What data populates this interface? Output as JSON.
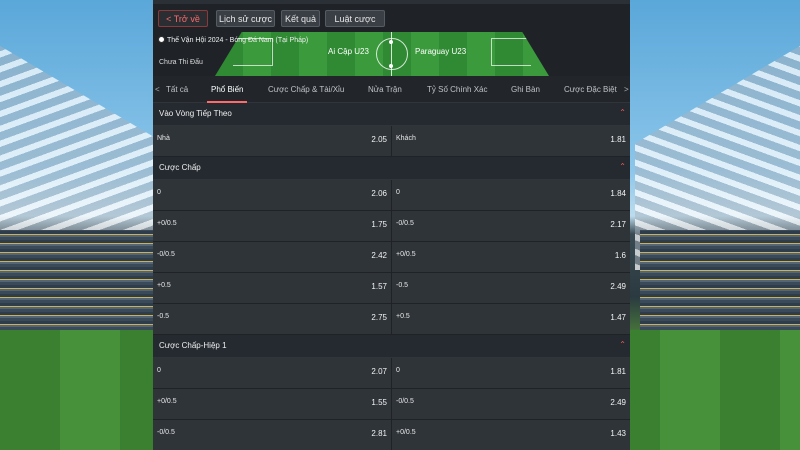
{
  "toolbar": {
    "back_label": "< Trở về",
    "history_label": "Lịch sử cược",
    "results_label": "Kết quả",
    "rules_label": "Luật cược"
  },
  "match": {
    "title": "Thế Vận Hội 2024 - Bóng Đá Nam (Tại Pháp)",
    "status": "Chưa Thi Đấu",
    "home_team": "Ai Cập U23",
    "away_team": "Paraguay U23"
  },
  "tabs": {
    "prev": "<",
    "next": ">",
    "items": [
      {
        "label": "Tất cả"
      },
      {
        "label": "Phổ Biến"
      },
      {
        "label": "Cược Chấp & Tài/Xỉu"
      },
      {
        "label": "Nửa Trận"
      },
      {
        "label": "Tỷ Số Chính Xác"
      },
      {
        "label": "Ghi Bàn"
      },
      {
        "label": "Cược Đặc Biệt"
      }
    ],
    "active_index": 1
  },
  "sections": [
    {
      "title": "Vào Vòng Tiếp Theo",
      "rows": [
        {
          "left": {
            "label": "Nhà",
            "odd": "2.05"
          },
          "right": {
            "label": "Khách",
            "odd": "1.81"
          }
        }
      ]
    },
    {
      "title": "Cược Chấp",
      "rows": [
        {
          "left": {
            "label": "0",
            "odd": "2.06"
          },
          "right": {
            "label": "0",
            "odd": "1.84"
          }
        },
        {
          "left": {
            "label": "+0/0.5",
            "odd": "1.75"
          },
          "right": {
            "label": "-0/0.5",
            "odd": "2.17"
          }
        },
        {
          "left": {
            "label": "-0/0.5",
            "odd": "2.42"
          },
          "right": {
            "label": "+0/0.5",
            "odd": "1.6"
          }
        },
        {
          "left": {
            "label": "+0.5",
            "odd": "1.57"
          },
          "right": {
            "label": "-0.5",
            "odd": "2.49"
          }
        },
        {
          "left": {
            "label": "-0.5",
            "odd": "2.75"
          },
          "right": {
            "label": "+0.5",
            "odd": "1.47"
          }
        }
      ]
    },
    {
      "title": "Cược Chấp-Hiệp 1",
      "rows": [
        {
          "left": {
            "label": "0",
            "odd": "2.07"
          },
          "right": {
            "label": "0",
            "odd": "1.81"
          }
        },
        {
          "left": {
            "label": "+0/0.5",
            "odd": "1.55"
          },
          "right": {
            "label": "-0/0.5",
            "odd": "2.49"
          }
        },
        {
          "left": {
            "label": "-0/0.5",
            "odd": "2.81"
          },
          "right": {
            "label": "+0/0.5",
            "odd": "1.43"
          }
        }
      ]
    }
  ],
  "icons": {
    "collapse": "chevron-up-icon",
    "ball": "soccer-ball-icon"
  },
  "colors": {
    "accent": "#ff6b6b",
    "panel": "#1f2328",
    "cell": "#2f3439"
  }
}
